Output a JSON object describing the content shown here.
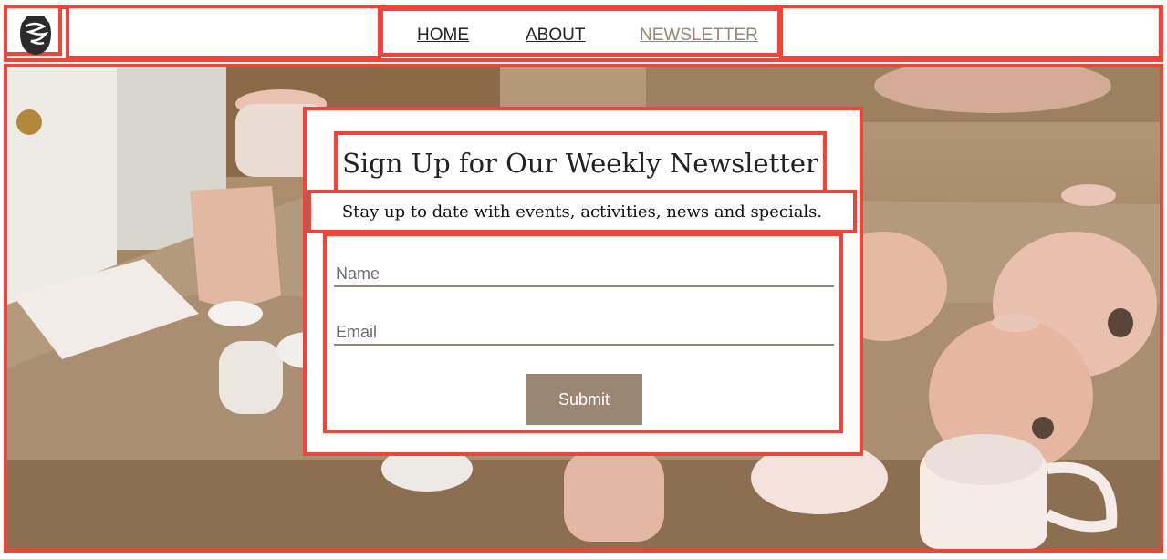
{
  "brand": {
    "logo_icon": "pottery-vase-logo-icon"
  },
  "nav": {
    "items": [
      {
        "label": "HOME",
        "active": false
      },
      {
        "label": "ABOUT",
        "active": false
      },
      {
        "label": "NEWSLETTER",
        "active": true
      }
    ]
  },
  "newsletter": {
    "title": "Sign Up for Our Weekly Newsletter",
    "subtitle": "Stay up to date with events, activities, news and specials.",
    "name_placeholder": "Name",
    "email_placeholder": "Email",
    "submit_label": "Submit"
  },
  "colors": {
    "accent": "#9b8674",
    "outline": "#f44336"
  }
}
